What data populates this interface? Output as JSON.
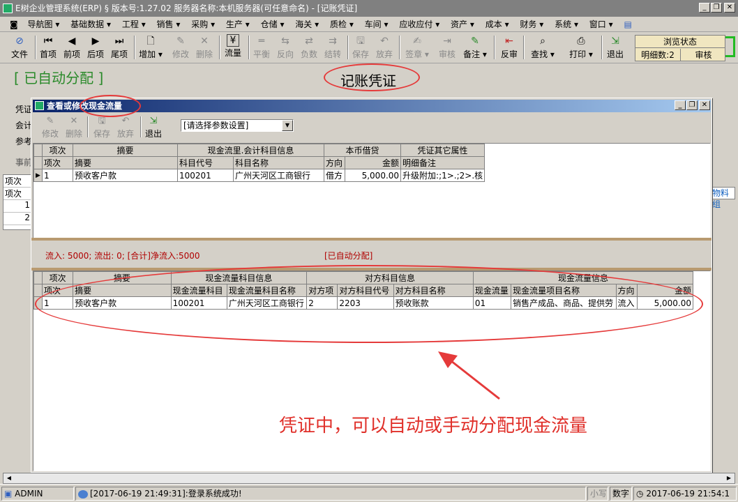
{
  "window": {
    "title": "E树企业管理系统(ERP) § 版本号:1.27.02  服务器名称:本机服务器(可任意命名) - [记账凭证]"
  },
  "menu": [
    "导航图",
    "基础数据",
    "工程",
    "销售",
    "采购",
    "生产",
    "仓储",
    "海关",
    "质检",
    "车间",
    "应收应付",
    "资产",
    "成本",
    "财务",
    "系统",
    "窗口"
  ],
  "toolbar": {
    "file": "文件",
    "first": "首项",
    "prev": "前项",
    "next": "后项",
    "last": "尾项",
    "add": "增加",
    "edit": "修改",
    "delete": "删除",
    "cashflow": "流量",
    "balance": "平衡",
    "reverse": "反向",
    "negative": "负数",
    "carry": "结转",
    "save": "保存",
    "discard": "放弃",
    "sign": "签章",
    "review": "审核",
    "remark": "备注",
    "unreview": "反审",
    "find": "查找",
    "print": "打印",
    "exit": "退出"
  },
  "browse": {
    "title": "浏览状态",
    "detail_count": "明细数:2",
    "review": "审核"
  },
  "voucher": {
    "auto_status": "[ 已自动分配 ]",
    "title": "记账凭证"
  },
  "bg_labels": [
    "凭证",
    "会计",
    "参考",
    "事前"
  ],
  "bg_grid": [
    "项次",
    "项次",
    "1",
    "2"
  ],
  "bg_right": "物料组",
  "dialog": {
    "title": "查看或修改现金流量",
    "toolbar": {
      "edit": "修改",
      "delete": "删除",
      "save": "保存",
      "discard": "放弃",
      "exit": "退出"
    },
    "param_select": "[请选择参数设置]",
    "upper": {
      "group_headers": [
        "项次",
        "摘要",
        "现金流里.会计科目信息",
        "本币借贷",
        "凭证其它属性"
      ],
      "headers": [
        "项次",
        "摘要",
        "科目代号",
        "科目名称",
        "方向",
        "金额",
        "明细备注"
      ],
      "rows": [
        [
          "1",
          "预收客户款",
          "100201",
          "广州天河区工商银行",
          "借方",
          "5,000.00",
          "升级附加:;1>.;2>.核"
        ]
      ]
    },
    "summary": "流入: 5000; 流出: 0;  [合计]净流入:5000",
    "auto_status": "[已自动分配]",
    "lower": {
      "group_headers": [
        "项次",
        "摘要",
        "现金流量科目信息",
        "对方科目信息",
        "现金流量信息"
      ],
      "headers": [
        "项次",
        "摘要",
        "现金流量科目",
        "现金流量科目名称",
        "对方项",
        "对方科目代号",
        "对方科目名称",
        "现金流量",
        "现金流量项目名称",
        "方向",
        "金额"
      ],
      "rows": [
        [
          "1",
          "预收客户款",
          "100201",
          "广州天河区工商银行",
          "2",
          "2203",
          "预收账款",
          "01",
          "销售产成品、商品、提供劳",
          "流入",
          "5,000.00"
        ]
      ]
    }
  },
  "annotation": "凭证中，可以自动或手动分配现金流量",
  "status": {
    "user": "ADMIN",
    "message": "[2017-06-19 21:49:31]:登录系统成功!",
    "caps": "小写",
    "num": "数字",
    "clock": "2017-06-19 21:54:1"
  }
}
